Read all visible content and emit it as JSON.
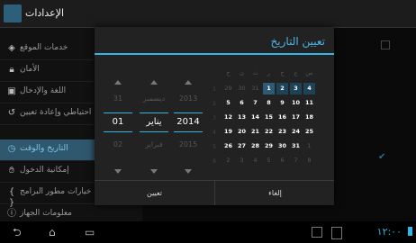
{
  "app": {
    "title": "الإعدادات",
    "icon": "settings-icon"
  },
  "sidebar": {
    "items": [
      {
        "label": "خدمات الموقع",
        "icon": "location-icon"
      },
      {
        "label": "الأمان",
        "icon": "lock-icon"
      },
      {
        "label": "اللغة والإدخال",
        "icon": "keyboard-icon"
      },
      {
        "label": "احتياطي وإعادة تعيين",
        "icon": "backup-icon"
      },
      {
        "label": "التاريخ والوقت",
        "icon": "clock-icon",
        "active": true
      },
      {
        "label": "إمكانية الدخول",
        "icon": "hand-icon"
      },
      {
        "label": "خيارات مطور البرامج",
        "icon": "braces-icon"
      },
      {
        "label": "معلومات الجهاز",
        "icon": "info-icon"
      }
    ]
  },
  "dialog": {
    "title": "تعيين التاريخ",
    "set_label": "تعيين",
    "cancel_label": "إلغاء",
    "spinners": {
      "day": {
        "prev": "31",
        "current": "01",
        "next": "02"
      },
      "month": {
        "prev": "ديسمبر",
        "current": "يناير",
        "next": "فبراير"
      },
      "year": {
        "prev": "2013",
        "current": "2014",
        "next": "2015"
      }
    },
    "calendar": {
      "week_numbers": [
        "1",
        "2",
        "3",
        "4",
        "5",
        "6"
      ],
      "weekdays": [
        "ح",
        "ن",
        "ث",
        "ر",
        "خ",
        "ج",
        "س"
      ],
      "rows": [
        [
          "29",
          "30",
          "31",
          "1",
          "2",
          "3",
          "4"
        ],
        [
          "5",
          "6",
          "7",
          "8",
          "9",
          "10",
          "11"
        ],
        [
          "12",
          "13",
          "14",
          "15",
          "16",
          "17",
          "18"
        ],
        [
          "19",
          "20",
          "21",
          "22",
          "23",
          "24",
          "25"
        ],
        [
          "26",
          "27",
          "28",
          "29",
          "30",
          "31",
          "1"
        ],
        [
          "2",
          "3",
          "4",
          "5",
          "6",
          "7",
          "8"
        ]
      ],
      "selected_day": "1"
    }
  },
  "status": {
    "time": "١٢:٠٠"
  },
  "colors": {
    "accent": "#33b5e5",
    "active_bg": "#2f586f"
  }
}
